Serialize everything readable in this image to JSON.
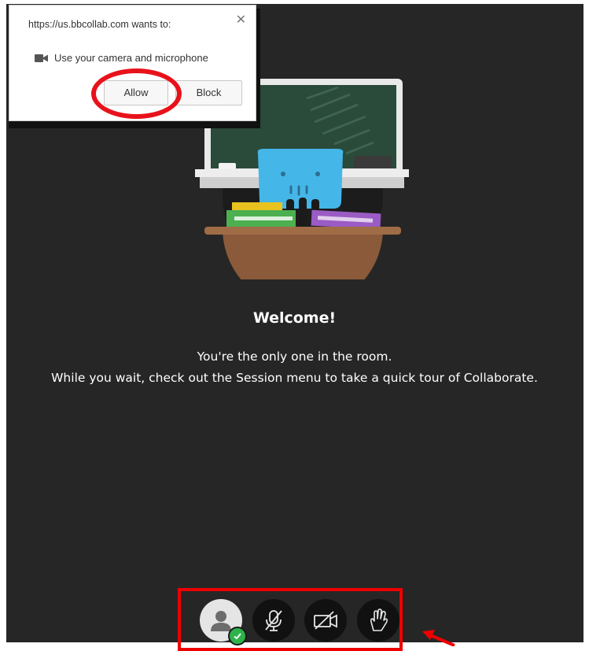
{
  "permission_dialog": {
    "title": "https://us.bbcollab.com wants to:",
    "close_glyph": "✕",
    "request_icon": "video-camera-icon",
    "request_text": "Use your camera and microphone",
    "allow_label": "Allow",
    "block_label": "Block"
  },
  "welcome": {
    "title": "Welcome!",
    "line1": "You're the only one in the room.",
    "line2": "While you wait, check out the Session menu to take a quick tour of Collaborate."
  },
  "toolbar": {
    "items": [
      {
        "name": "my-status-and-settings",
        "icon": "user-avatar-icon",
        "status": "available"
      },
      {
        "name": "share-audio",
        "icon": "microphone-muted-icon"
      },
      {
        "name": "share-video",
        "icon": "camera-off-icon"
      },
      {
        "name": "raise-hand",
        "icon": "hand-icon"
      }
    ]
  },
  "colors": {
    "stage_background": "#262626",
    "highlight_red": "#e8121b",
    "status_green": "#2db34a",
    "chalkboard_green": "#2a4a3a",
    "desk_brown": "#8a5a3a",
    "chair_blue": "#45b6e8"
  }
}
